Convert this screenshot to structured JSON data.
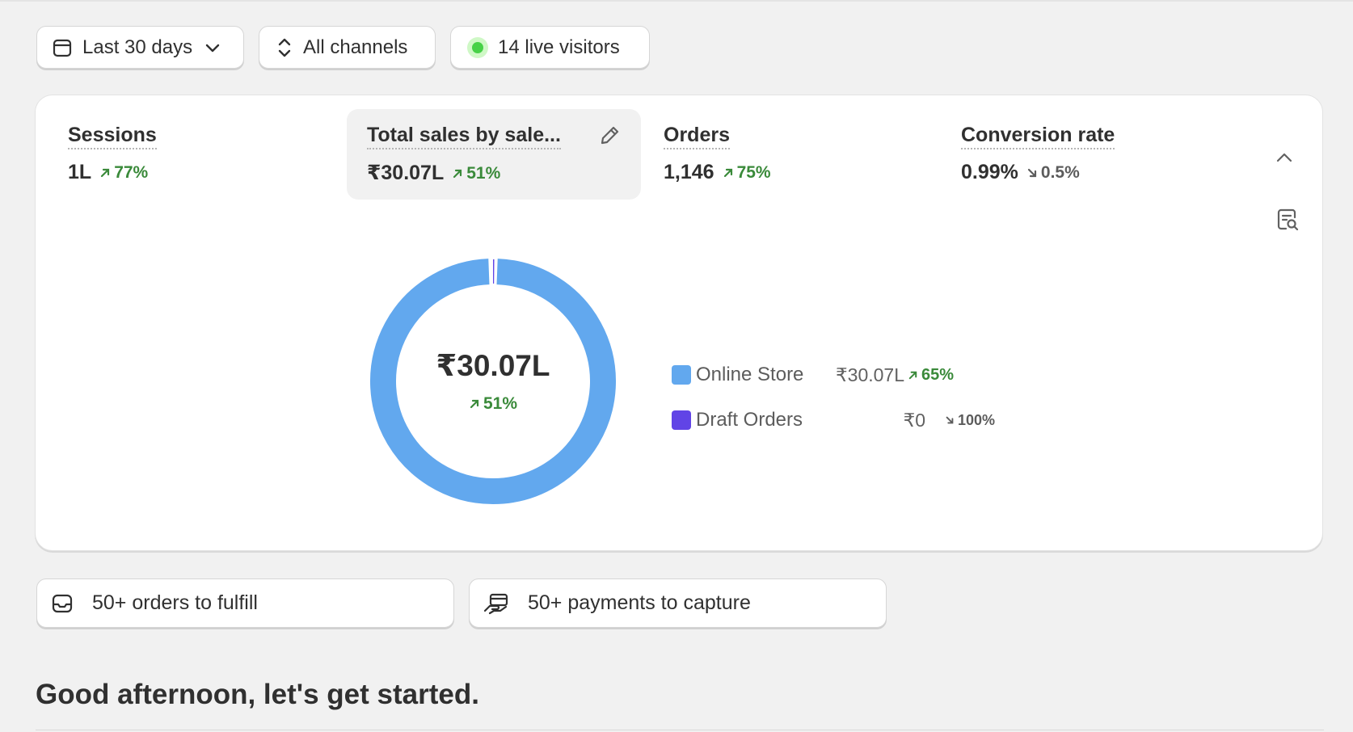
{
  "filters": {
    "date_range": "Last 30 days",
    "channels": "All channels",
    "live_visitors": "14 live visitors"
  },
  "metrics": [
    {
      "title": "Sessions",
      "value": "1L",
      "change": "77%",
      "direction": "up"
    },
    {
      "title": "Total sales by sale...",
      "value": "₹30.07L",
      "change": "51%",
      "direction": "up"
    },
    {
      "title": "Orders",
      "value": "1,146",
      "change": "75%",
      "direction": "up"
    },
    {
      "title": "Conversion rate",
      "value": "0.99%",
      "change": "0.5%",
      "direction": "down"
    }
  ],
  "chart_data": {
    "type": "pie",
    "style": "donut",
    "center_value": "₹30.07L",
    "center_change": "51%",
    "categories": [
      "Online Store",
      "Draft Orders"
    ],
    "values": [
      3007000,
      0
    ],
    "value_labels": [
      "₹30.07L",
      "₹0"
    ],
    "changes": [
      "65%",
      "100%"
    ],
    "change_directions": [
      "up",
      "down"
    ],
    "colors": [
      "#62a8ee",
      "#6144e6"
    ],
    "legend_position": "right"
  },
  "tasks": {
    "fulfill": "50+ orders to fulfill",
    "capture": "50+ payments to capture"
  },
  "greeting": "Good afternoon, let's get started."
}
